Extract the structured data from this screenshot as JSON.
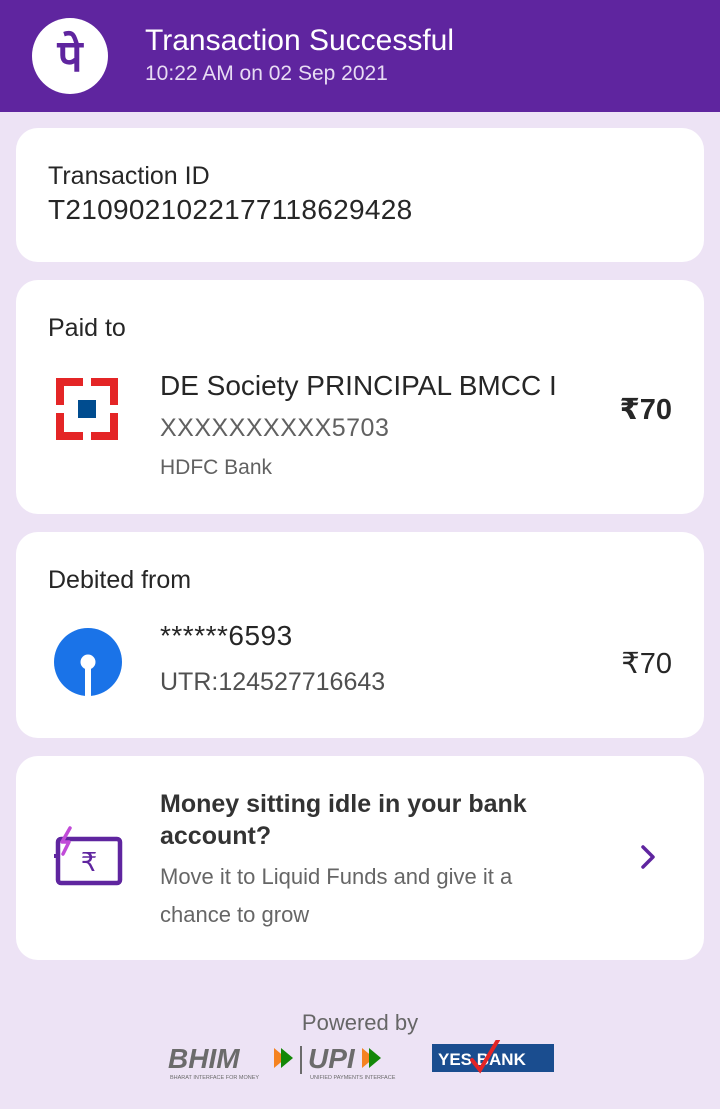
{
  "header": {
    "title": "Transaction Successful",
    "subtitle": "10:22 AM on 02 Sep 2021",
    "logo_icon": "phonepe-logo-icon",
    "background": "#5f259f"
  },
  "transaction": {
    "label": "Transaction ID",
    "id": "T2109021022177118629428"
  },
  "paid_to": {
    "label": "Paid to",
    "name": "DE Society PRINCIPAL BMCC I",
    "account": "XXXXXXXXXX5703",
    "bank": "HDFC Bank",
    "amount": "₹70",
    "bank_icon": "hdfc-bank-icon"
  },
  "debited_from": {
    "label": "Debited from",
    "account": "******6593",
    "utr": "UTR:124527716643",
    "amount": "₹70",
    "bank_icon": "sbi-bank-icon"
  },
  "promo": {
    "title": "Money sitting idle in your bank account?",
    "description": "Move it to Liquid Funds and give it a chance to grow",
    "icon": "wallet-rupee-icon"
  },
  "footer": {
    "powered_by": "Powered by",
    "bhim": "BHIM",
    "bhim_tagline": "BHARAT INTERFACE FOR MONEY",
    "upi": "UPI",
    "upi_tagline": "UNIFIED PAYMENTS INTERFACE",
    "yes_bank": "YES BANK"
  },
  "colors": {
    "page_background": "#ede3f5",
    "accent": "#5f259f",
    "hdfc_red": "#e42526",
    "hdfc_blue": "#004c8f",
    "sbi_blue": "#1a73e8",
    "yes_bank_blue": "#1a4d8f"
  }
}
